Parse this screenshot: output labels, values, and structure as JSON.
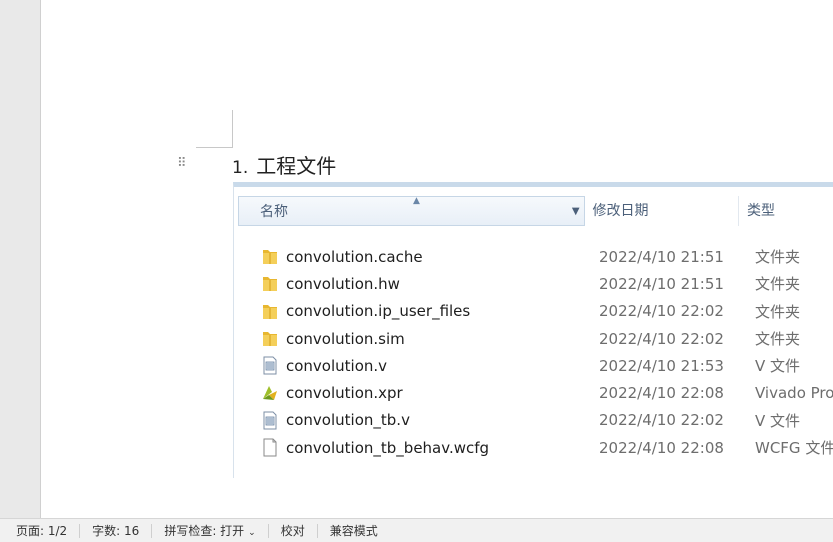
{
  "document": {
    "heading_number": "1.",
    "heading_text": "工程文件",
    "drag_handle_glyph": "⠿"
  },
  "explorer": {
    "columns": {
      "name": "名称",
      "date": "修改日期",
      "type": "类型"
    },
    "rows": [
      {
        "name": "convolution.cache",
        "date": "2022/4/10 21:51",
        "type": "文件夹",
        "icon": "folder-icon"
      },
      {
        "name": "convolution.hw",
        "date": "2022/4/10 21:51",
        "type": "文件夹",
        "icon": "folder-icon"
      },
      {
        "name": "convolution.ip_user_files",
        "date": "2022/4/10 22:02",
        "type": "文件夹",
        "icon": "folder-icon"
      },
      {
        "name": "convolution.sim",
        "date": "2022/4/10 22:02",
        "type": "文件夹",
        "icon": "folder-icon"
      },
      {
        "name": "convolution.v",
        "date": "2022/4/10 21:53",
        "type": "V 文件",
        "icon": "text-file-icon"
      },
      {
        "name": "convolution.xpr",
        "date": "2022/4/10 22:08",
        "type": "Vivado Pro",
        "icon": "vivado-project-icon"
      },
      {
        "name": "convolution_tb.v",
        "date": "2022/4/10 22:02",
        "type": "V 文件",
        "icon": "text-file-icon"
      },
      {
        "name": "convolution_tb_behav.wcfg",
        "date": "2022/4/10 22:08",
        "type": "WCFG 文件",
        "icon": "blank-file-icon"
      }
    ]
  },
  "statusbar": {
    "page": "页面: 1/2",
    "word_count": "字数: 16",
    "spell_check": "拼写检查: 打开",
    "proofread": "校对",
    "compat_mode": "兼容模式"
  },
  "colors": {
    "folder": "#e8b730",
    "header_text": "#4c607a",
    "secondary_text": "#6d6d6d"
  }
}
